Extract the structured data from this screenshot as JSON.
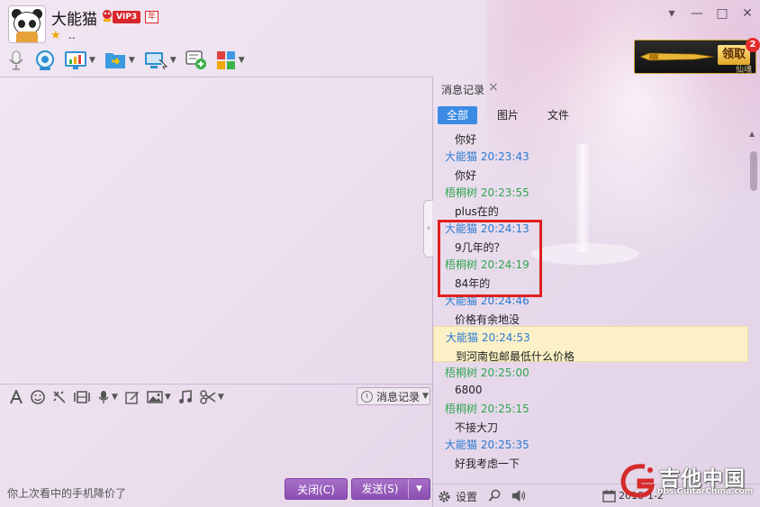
{
  "header": {
    "user_name": "大能猫",
    "vip_badge": "VIP3",
    "vip_year": "年",
    "signature": ".."
  },
  "window_controls": {
    "skin": "👕",
    "minimize": "—",
    "maximize": "□",
    "close": "✕"
  },
  "ad": {
    "claim_label": "领取",
    "sub_label": "仙魂",
    "badge_count": "2"
  },
  "history": {
    "title": "消息记录",
    "filters": [
      "全部",
      "图片",
      "文件"
    ],
    "messages": [
      {
        "sender": "",
        "time": "",
        "text": "你好",
        "self": false,
        "highlight": false
      },
      {
        "sender": "大能猫",
        "time": "20:23:43",
        "text": "你好",
        "self": true,
        "highlight": false
      },
      {
        "sender": "梧桐树",
        "time": "20:23:55",
        "text": "plus在的",
        "self": false,
        "highlight": false
      },
      {
        "sender": "大能猫",
        "time": "20:24:13",
        "text": "9几年的？",
        "self": true,
        "highlight": false
      },
      {
        "sender": "梧桐树",
        "time": "20:24:19",
        "text": "84年的",
        "self": false,
        "highlight": false
      },
      {
        "sender": "大能猫",
        "time": "20:24:46",
        "text": "价格有余地没",
        "self": true,
        "highlight": false
      },
      {
        "sender": "大能猫",
        "time": "20:24:53",
        "text": "到河南包邮最低什么价格",
        "self": true,
        "highlight": true
      },
      {
        "sender": "梧桐树",
        "time": "20:25:00",
        "text": "6800",
        "self": false,
        "highlight": false
      },
      {
        "sender": "梧桐树",
        "time": "20:25:15",
        "text": "不接大刀",
        "self": false,
        "highlight": false
      },
      {
        "sender": "大能猫",
        "time": "20:25:35",
        "text": "好我考虑一下",
        "self": true,
        "highlight": false
      }
    ],
    "footer": {
      "settings_label": "设置",
      "date": "2018-1-2"
    }
  },
  "input": {
    "history_button_label": "消息记录",
    "tip_text": "你上次看中的手机降价了",
    "close_button_label": "关闭(C)",
    "send_button_label": "发送(S)"
  },
  "watermark": {
    "title": "吉他中国",
    "url": "bbs.GuitarChina.com"
  },
  "colors": {
    "accent": "#8b4fb2",
    "self_name": "#2a7ad2",
    "other_name": "#30a650",
    "active_filter": "#3b8be4",
    "highlight_row": "#fbf0c6",
    "annotation_box": "#e02020"
  },
  "icons": {
    "toolbar": [
      "microphone-icon",
      "video-camera-icon",
      "screen-share-icon",
      "send-file-icon",
      "remote-desktop-icon",
      "add-app-icon",
      "apps-grid-icon"
    ],
    "input_toolbar": [
      "font-icon",
      "emoji-icon",
      "nudge-icon",
      "screenshot-icon",
      "voice-message-icon",
      "edit-icon",
      "image-icon",
      "music-icon",
      "scissors-icon"
    ]
  }
}
